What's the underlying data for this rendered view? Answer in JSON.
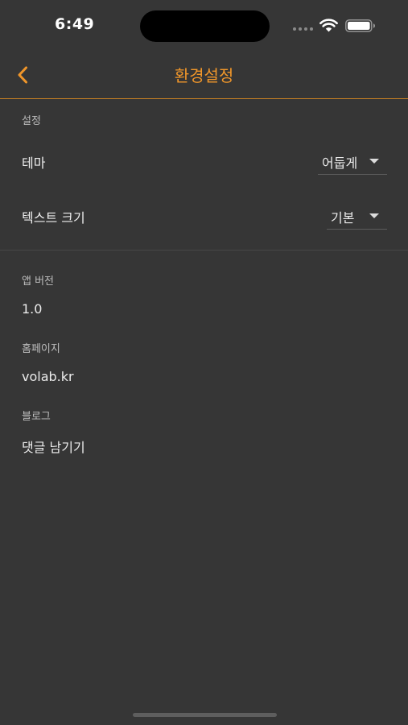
{
  "status_bar": {
    "time": "6:49"
  },
  "nav": {
    "title": "환경설정",
    "back_icon": "chevron-left-icon",
    "accent_color": "#f0962a"
  },
  "settings_section": {
    "label": "설정",
    "theme": {
      "label": "테마",
      "selected": "어둡게"
    },
    "text_size": {
      "label": "텍스트 크기",
      "selected": "기본"
    }
  },
  "info_section": {
    "app_version": {
      "label": "앱 버전",
      "value": "1.0"
    },
    "homepage": {
      "label": "홈페이지",
      "value": "volab.kr"
    },
    "blog": {
      "label": "블로그",
      "value": "댓글 남기기"
    }
  }
}
